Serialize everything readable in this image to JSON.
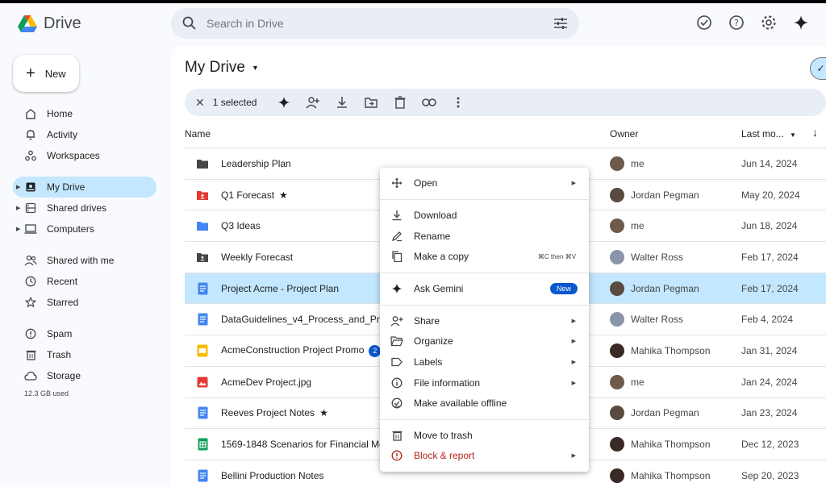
{
  "app": {
    "name": "Drive"
  },
  "search": {
    "placeholder": "Search in Drive"
  },
  "top_icons": [
    "offline-ready-icon",
    "help-icon",
    "settings-icon",
    "gemini-sparkle-icon"
  ],
  "new_button": {
    "label": "New"
  },
  "nav": {
    "items": [
      {
        "label": "Home",
        "icon": "home-icon"
      },
      {
        "label": "Activity",
        "icon": "bell-icon"
      },
      {
        "label": "Workspaces",
        "icon": "workspaces-icon"
      },
      {
        "label": "My Drive",
        "icon": "my-drive-icon",
        "active": true,
        "caret": true
      },
      {
        "label": "Shared drives",
        "icon": "shared-drives-icon",
        "caret": true
      },
      {
        "label": "Computers",
        "icon": "computer-icon",
        "caret": true
      },
      {
        "label": "Shared with me",
        "icon": "people-icon"
      },
      {
        "label": "Recent",
        "icon": "clock-icon"
      },
      {
        "label": "Starred",
        "icon": "star-icon"
      },
      {
        "label": "Spam",
        "icon": "spam-icon"
      },
      {
        "label": "Trash",
        "icon": "trash-icon"
      },
      {
        "label": "Storage",
        "icon": "cloud-icon"
      }
    ],
    "storage_used": "12.3 GB used"
  },
  "main": {
    "title": "My Drive",
    "selection": {
      "count_label": "1 selected"
    },
    "columns": {
      "name": "Name",
      "owner": "Owner",
      "modified": "Last mo..."
    },
    "files": [
      {
        "name": "Leadership Plan",
        "type": "folder-dark",
        "owner": "me",
        "modified": "Jun 14, 2024"
      },
      {
        "name": "Q1 Forecast",
        "type": "folder-red",
        "starred": true,
        "owner": "Jordan Pegman",
        "modified": "May 20, 2024"
      },
      {
        "name": "Q3 Ideas",
        "type": "folder-blue",
        "owner": "me",
        "modified": "Jun 18, 2024"
      },
      {
        "name": "Weekly Forecast",
        "type": "folder-shared",
        "owner": "Walter Ross",
        "modified": "Feb 17, 2024"
      },
      {
        "name": "Project Acme - Project Plan",
        "type": "doc",
        "owner": "Jordan Pegman",
        "modified": "Feb 17, 2024",
        "selected": true
      },
      {
        "name": "DataGuidelines_v4_Process_and_Pro",
        "type": "doc",
        "owner": "Walter Ross",
        "modified": "Feb 4, 2024"
      },
      {
        "name": "AcmeConstruction Project Promo",
        "type": "slides",
        "badge": "2",
        "owner": "Mahika Thompson",
        "modified": "Jan 31, 2024"
      },
      {
        "name": "AcmeDev Project.jpg",
        "type": "image",
        "owner": "me",
        "modified": "Jan 24, 2024"
      },
      {
        "name": "Reeves Project Notes",
        "type": "doc",
        "starred": true,
        "owner": "Jordan Pegman",
        "modified": "Jan 23, 2024"
      },
      {
        "name": "1569-1848 Scenarios for Financial Mod",
        "type": "sheet",
        "owner": "Mahika Thompson",
        "modified": "Dec 12, 2023"
      },
      {
        "name": "Bellini Production Notes",
        "type": "doc",
        "owner": "Mahika Thompson",
        "modified": "Sep 20, 2023"
      }
    ]
  },
  "context_menu": {
    "items": [
      {
        "label": "Open",
        "icon": "open-with-icon",
        "submenu": true
      },
      {
        "label": "Download",
        "icon": "download-icon"
      },
      {
        "label": "Rename",
        "icon": "rename-icon"
      },
      {
        "label": "Make a copy",
        "icon": "copy-icon",
        "shortcut": "⌘C then ⌘V"
      },
      {
        "label": "Ask Gemini",
        "icon": "gemini-sparkle-icon",
        "badge": "New"
      },
      {
        "label": "Share",
        "icon": "share-icon",
        "submenu": true
      },
      {
        "label": "Organize",
        "icon": "folder-open-icon",
        "submenu": true
      },
      {
        "label": "Labels",
        "icon": "label-icon",
        "submenu": true
      },
      {
        "label": "File information",
        "icon": "info-icon",
        "submenu": true
      },
      {
        "label": "Make available offline",
        "icon": "offline-icon"
      },
      {
        "label": "Move to trash",
        "icon": "trash-icon"
      },
      {
        "label": "Block & report",
        "icon": "report-icon",
        "submenu": true,
        "danger": true
      }
    ]
  },
  "colors": {
    "accent": "#c2e7ff",
    "selection_bar": "#e9eef6",
    "danger": "#b3261e",
    "badge": "#0b57d0"
  }
}
